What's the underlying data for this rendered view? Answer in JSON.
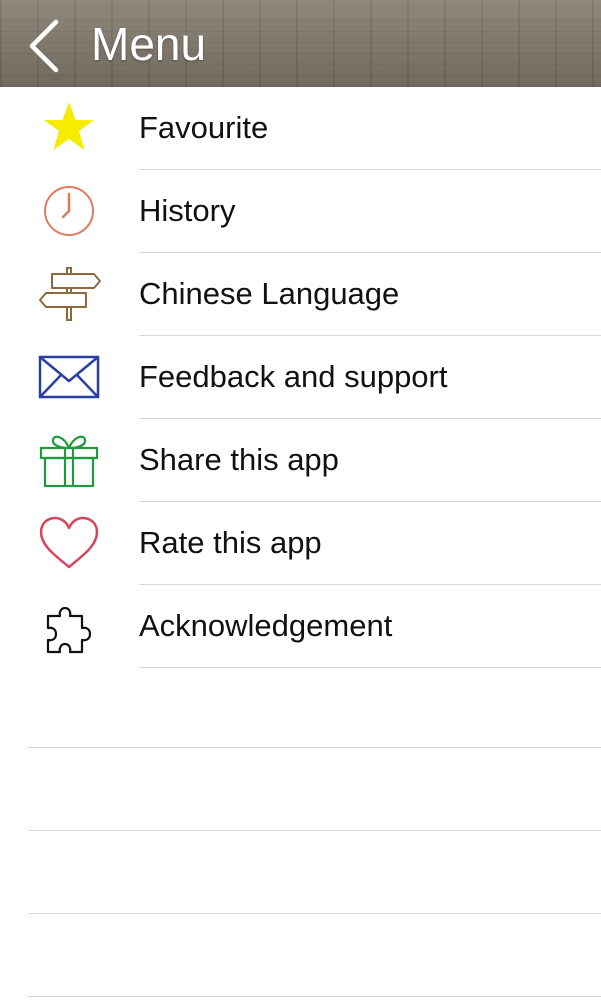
{
  "header": {
    "title": "Menu",
    "back_icon": "chevron-left-icon"
  },
  "menu": {
    "items": [
      {
        "label": "Favourite",
        "icon": "star-icon",
        "color": "#f5ec00"
      },
      {
        "label": "History",
        "icon": "clock-icon",
        "color": "#e07a5f"
      },
      {
        "label": "Chinese Language",
        "icon": "signpost-icon",
        "color": "#8b6a3e"
      },
      {
        "label": "Feedback and support",
        "icon": "envelope-icon",
        "color": "#2b3fa3"
      },
      {
        "label": "Share this app",
        "icon": "gift-icon",
        "color": "#1f9a3c"
      },
      {
        "label": "Rate this app",
        "icon": "heart-icon",
        "color": "#d9435a"
      },
      {
        "label": "Acknowledgement",
        "icon": "puzzle-icon",
        "color": "#111111"
      }
    ]
  }
}
